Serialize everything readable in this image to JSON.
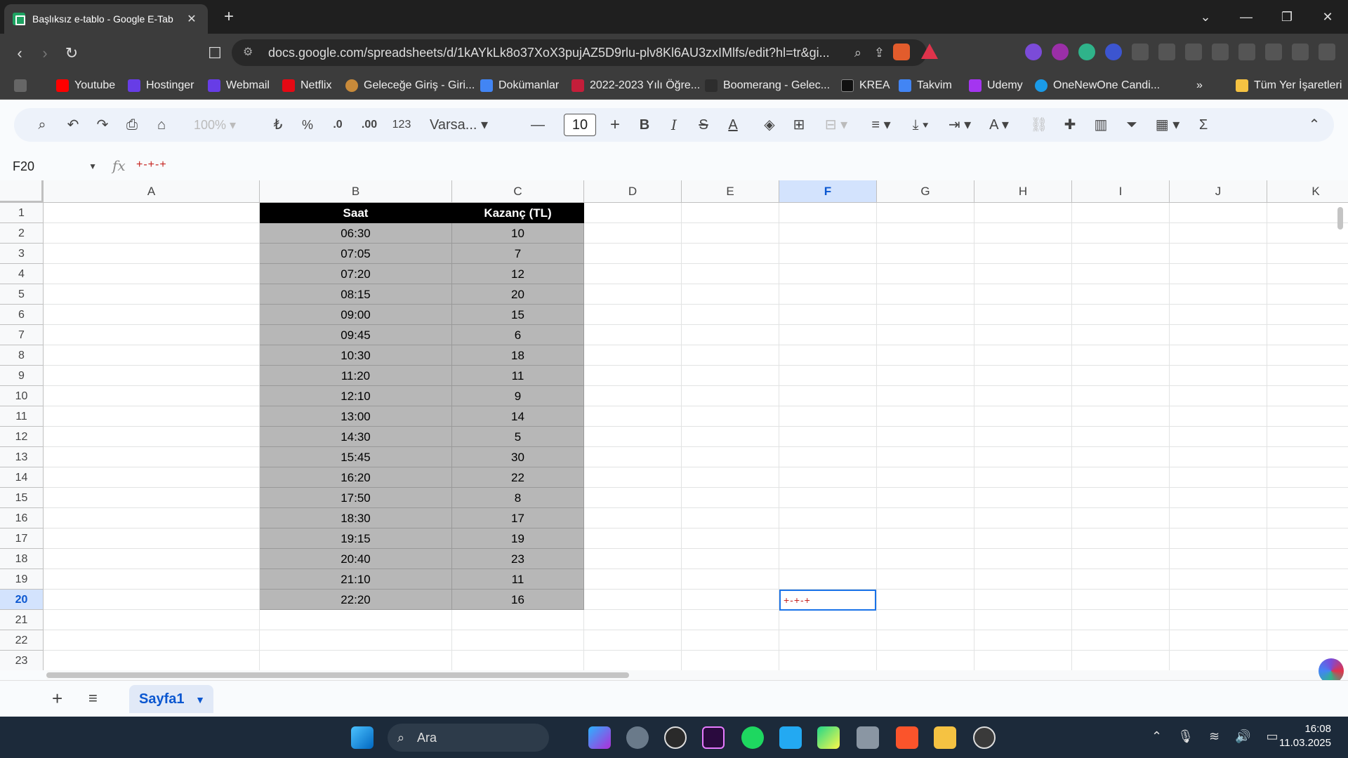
{
  "browser": {
    "tab_title": "Başlıksız e-tablo - Google E-Tab",
    "url": "docs.google.com/spreadsheets/d/1kAYkLk8o37XoX3pujAZ5D9rlu-plv8Kl6AU3zxIMlfs/edit?hl=tr&gi...",
    "bookmarks": [
      "Youtube",
      "Hostinger",
      "Webmail",
      "Netflix",
      "Geleceğe Giriş - Giri...",
      "Dokümanlar",
      "2022-2023 Yılı Öğre...",
      "Boomerang - Gelec...",
      "KREA",
      "Takvim",
      "Udemy",
      "OneNewOne Candi..."
    ],
    "all_bookmarks": "Tüm Yer İşaretleri"
  },
  "toolbar": {
    "zoom": "100%",
    "currency": "₺",
    "percent": "%",
    "dec_decrease": ".0",
    "dec_increase": ".00",
    "format_123": "123",
    "font": "Varsa...",
    "font_size": "10"
  },
  "formula": {
    "cell_ref": "F20",
    "fx": "fx",
    "value": "+-+-+"
  },
  "columns": [
    "A",
    "B",
    "C",
    "D",
    "E",
    "F",
    "G",
    "H",
    "I",
    "J",
    "K"
  ],
  "rows": [
    "1",
    "2",
    "3",
    "4",
    "5",
    "6",
    "7",
    "8",
    "9",
    "10",
    "11",
    "12",
    "13",
    "14",
    "15",
    "16",
    "17",
    "18",
    "19",
    "20",
    "21",
    "22",
    "23"
  ],
  "sheet": {
    "header": [
      "Saat",
      "Kazanç (TL)"
    ],
    "data": [
      [
        "06:30",
        "10"
      ],
      [
        "07:05",
        "7"
      ],
      [
        "07:20",
        "12"
      ],
      [
        "08:15",
        "20"
      ],
      [
        "09:00",
        "15"
      ],
      [
        "09:45",
        "6"
      ],
      [
        "10:30",
        "18"
      ],
      [
        "11:20",
        "11"
      ],
      [
        "12:10",
        "9"
      ],
      [
        "13:00",
        "14"
      ],
      [
        "14:30",
        "5"
      ],
      [
        "15:45",
        "30"
      ],
      [
        "16:20",
        "22"
      ],
      [
        "17:50",
        "8"
      ],
      [
        "18:30",
        "17"
      ],
      [
        "19:15",
        "19"
      ],
      [
        "20:40",
        "23"
      ],
      [
        "21:10",
        "11"
      ],
      [
        "22:20",
        "16"
      ]
    ],
    "active_cell_value": "+-+-+"
  },
  "sheet_tab": "Sayfa1",
  "taskbar": {
    "search": "Ara",
    "time": "16:08",
    "date": "11.03.2025"
  }
}
